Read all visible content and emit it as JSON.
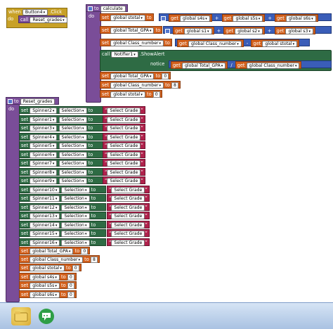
{
  "when_block": {
    "when": "when",
    "component": "Button4",
    "event": ".Click",
    "do": "do",
    "call": "call",
    "proc": "Reset_grades"
  },
  "calculate": {
    "to": "to",
    "name": "calculate",
    "do": "do",
    "set": "set",
    "get": "get",
    "row1": {
      "target": "global stotal",
      "to": "to",
      "a": "global s4s",
      "b": "global s5s",
      "c": "global s6s"
    },
    "row2": {
      "target": "global Total_GPA",
      "to": "to",
      "a": "global s1",
      "b": "global s2",
      "c": "global s3"
    },
    "row3": {
      "target": "global Class_number",
      "to": "to",
      "a": "global Class_number",
      "b": "global stotal"
    },
    "call": "call",
    "notifier": "Notifier1",
    "method": ".ShowAlert",
    "notice": "notice",
    "alert_a": "global Total_GPA",
    "alert_b": "global Class_number",
    "row5": {
      "target": "global Total_GPA",
      "to": "to",
      "value": "0"
    },
    "row6": {
      "target": "global Class_number",
      "to": "to",
      "value": "8"
    },
    "row7": {
      "target": "global stotal",
      "to": "to",
      "value": "0"
    }
  },
  "reset": {
    "to": "to",
    "name": "Reset_grades",
    "do": "do",
    "set": "set",
    "to_kw": "to",
    "property": "Selection",
    "value": "Select Grade",
    "spinners": [
      "Spinner2",
      "Spinner1",
      "Spinner3",
      "Spinner4",
      "Spinner5",
      "Spinner6",
      "Spinner7",
      "Spinner8",
      "Spinner9",
      "Spinner10",
      "Spinner11",
      "Spinner12",
      "Spinner13",
      "Spinner14",
      "Spinner15",
      "Spinner16"
    ],
    "globals": [
      {
        "name": "global Total_GPA",
        "value": "0"
      },
      {
        "name": "global Class_number",
        "value": "8"
      },
      {
        "name": "global stotal",
        "value": "0"
      },
      {
        "name": "global s4s",
        "value": "0"
      },
      {
        "name": "global s5s",
        "value": "0"
      },
      {
        "name": "global s6s",
        "value": "0"
      }
    ]
  },
  "ops": {
    "plus": "+",
    "minus": "-",
    "divide": "/"
  },
  "colors": {
    "event": "#c8a127",
    "procedure": "#7a4d98",
    "variable": "#d2601c",
    "component": "#2e6b44",
    "text": "#b0224c",
    "math": "#3a5db8"
  },
  "taskbar": {
    "icons": [
      "windows-explorer-icon",
      "chrome-icon"
    ]
  }
}
